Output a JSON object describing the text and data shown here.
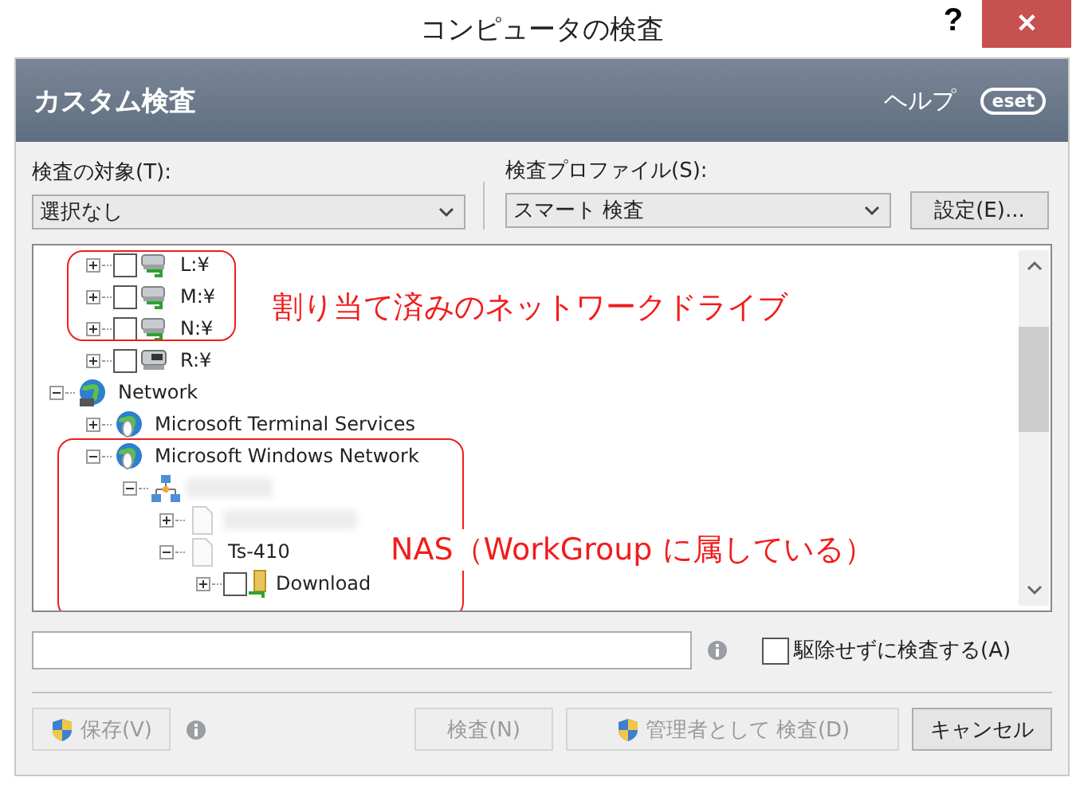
{
  "window": {
    "title": "コンピュータの検査",
    "help_glyph": "?",
    "close_glyph": "✕"
  },
  "header": {
    "title": "カスタム検査",
    "help": "ヘルプ",
    "logo": "eset"
  },
  "target": {
    "label": "検査の対象(T):",
    "value": "選択なし"
  },
  "profile": {
    "label": "検査プロファイル(S):",
    "value": "スマート 検査",
    "settings_button": "設定(E)..."
  },
  "tree": [
    {
      "kind": "continued",
      "children": [
        {
          "kind": "network-drive",
          "label": "L:¥",
          "expanded": false,
          "checked": false
        },
        {
          "kind": "network-drive",
          "label": "M:¥",
          "expanded": false,
          "checked": false
        },
        {
          "kind": "network-drive",
          "label": "N:¥",
          "expanded": false,
          "checked": false
        },
        {
          "kind": "disk-drive",
          "label": "R:¥",
          "expanded": false,
          "checked": false
        }
      ]
    },
    {
      "kind": "network",
      "label": "Network",
      "expanded": true,
      "children": [
        {
          "kind": "globe",
          "label": "Microsoft Terminal Services",
          "expanded": false
        },
        {
          "kind": "globe",
          "label": "Microsoft Windows Network",
          "expanded": true,
          "children": [
            {
              "kind": "workgroup",
              "blurred": true,
              "expanded": true,
              "children": [
                {
                  "kind": "page",
                  "blurred": true,
                  "expanded": false
                },
                {
                  "kind": "page",
                  "label": "Ts-410",
                  "expanded": true,
                  "children": [
                    {
                      "kind": "folder",
                      "label": "Download",
                      "expanded": false,
                      "checked": false
                    }
                  ]
                }
              ]
            }
          ]
        }
      ]
    }
  ],
  "annotations": [
    {
      "kind": "box"
    },
    {
      "kind": "label",
      "text": "割り当て済みのネットワークドライブ"
    },
    {
      "kind": "box"
    },
    {
      "kind": "label",
      "text": "NAS（WorkGroup に属している）"
    }
  ],
  "no_clean": {
    "label": "駆除せずに検査する(A)",
    "checked": false
  },
  "buttons": [
    {
      "kind": "shield",
      "label": "保存(V)",
      "disabled": true,
      "info": true
    },
    {
      "kind": "plain",
      "label": "検査(N)",
      "disabled": true
    },
    {
      "kind": "shield",
      "label": "管理者として 検査(D)",
      "disabled": true
    },
    {
      "kind": "plain",
      "label": "キャンセル",
      "disabled": false
    }
  ]
}
